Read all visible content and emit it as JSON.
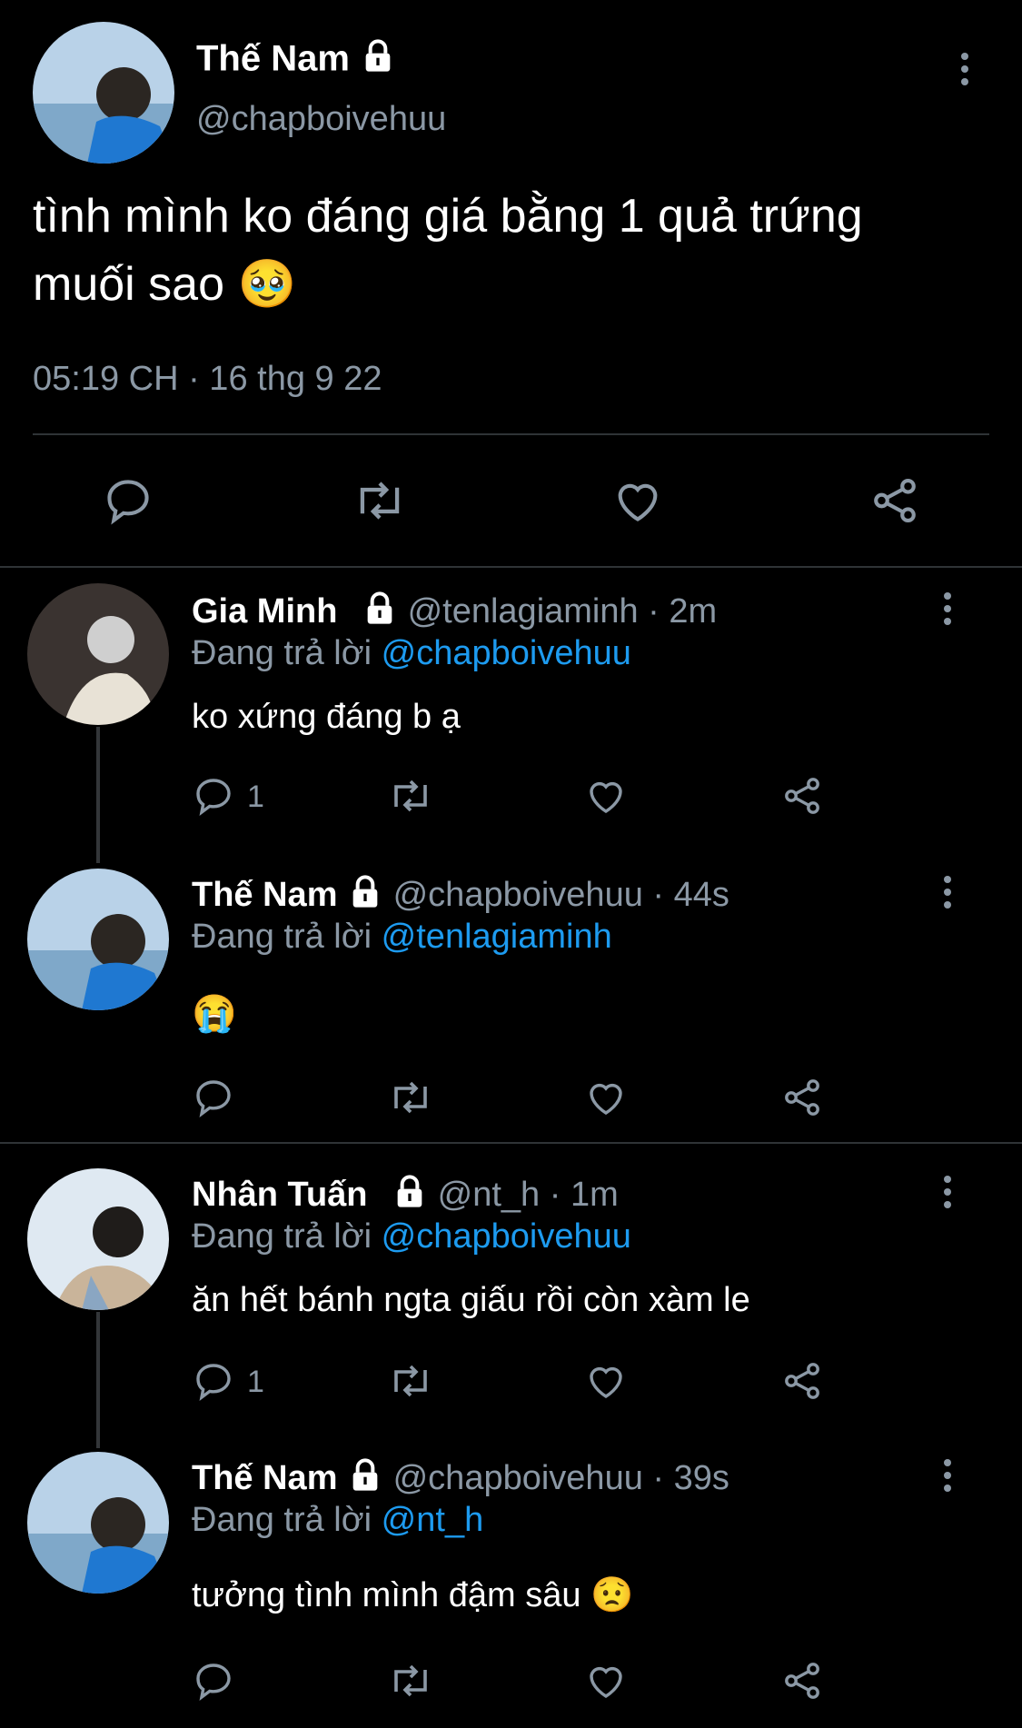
{
  "main_tweet": {
    "name": "Thế Nam",
    "handle": "@chapboivehuu",
    "text_line1": "tình mình ko đáng giá bằng 1 quả trứng",
    "text_line2": "muối sao 🥹",
    "timestamp": "05:19 CH · 16 thg 9 22"
  },
  "replies": [
    {
      "name": "Gia Minh",
      "handle_time": "@tenlagiaminh · 2m",
      "replying_label": "Đang trả lời",
      "replying_to": "@chapboivehuu",
      "text": "ko xứng đáng b ạ",
      "reply_count": "1"
    },
    {
      "name": "Thế Nam",
      "handle_time": "@chapboivehuu · 44s",
      "replying_label": "Đang trả lời",
      "replying_to": "@tenlagiaminh",
      "text": "😭",
      "reply_count": ""
    },
    {
      "name": "Nhân Tuấn",
      "handle_time": "@nt_h · 1m",
      "replying_label": "Đang trả lời",
      "replying_to": "@chapboivehuu",
      "text": "ăn hết bánh ngta giấu rồi còn xàm le",
      "reply_count": "1"
    },
    {
      "name": "Thế Nam",
      "handle_time": "@chapboivehuu · 39s",
      "replying_label": "Đang trả lời",
      "replying_to": "@nt_h",
      "text": "tưởng tình mình đậm sâu 😟",
      "reply_count": ""
    }
  ],
  "colors": {
    "background": "#000000",
    "text": "#ffffff",
    "muted": "#8b98a5",
    "link": "#1d9bf0",
    "divider": "#2f3336"
  },
  "icons": [
    "lock-icon",
    "more-icon",
    "reply-icon",
    "retweet-icon",
    "like-icon",
    "share-icon"
  ]
}
